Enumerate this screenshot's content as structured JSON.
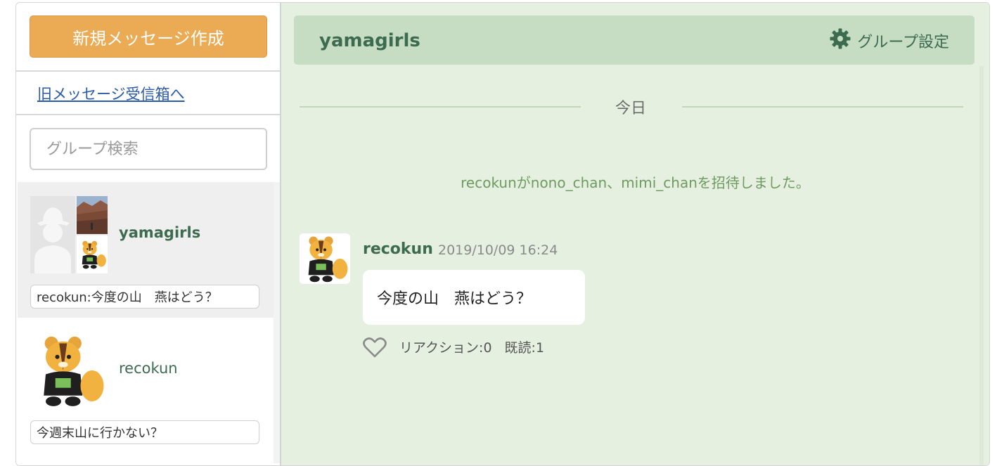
{
  "sidebar": {
    "compose_label": "新規メッセージ作成",
    "old_inbox_link": "旧メッセージ受信箱へ",
    "search_placeholder": "グループ検索",
    "groups": [
      {
        "name": "yamagirls",
        "preview": "recokun:今度の山　燕はどう？",
        "active": true
      },
      {
        "name": "recokun",
        "preview": "今週末山に行かない？",
        "active": false
      }
    ]
  },
  "chat": {
    "title": "yamagirls",
    "settings_label": "グループ設定",
    "date_separator": "今日",
    "system_message": "recokunがnono_chan、mimi_chanを招待しました。",
    "messages": [
      {
        "author": "recokun",
        "timestamp": "2019/10/09 16:24",
        "text": "今度の山　燕はどう？",
        "reaction_label": "リアクション:0",
        "read_label": "既読:1"
      }
    ]
  },
  "colors": {
    "accent_orange": "#ebab55",
    "brand_green": "#3d6b50",
    "header_green": "#c6ddc3",
    "chat_background": "#e6f0e0",
    "system_text": "#6f9a60"
  },
  "icons": {
    "settings": "gear-icon",
    "reaction": "heart-icon",
    "avatar_placeholder": "person-silhouette-icon",
    "mascot": "mascot-avatar"
  }
}
